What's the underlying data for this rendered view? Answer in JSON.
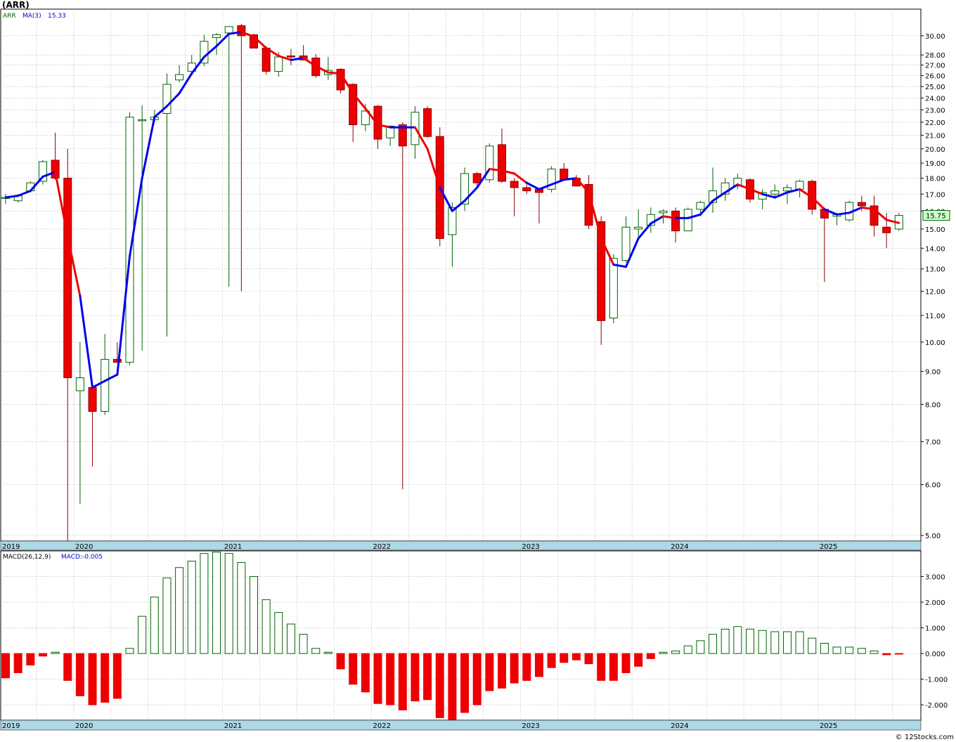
{
  "header": {
    "ticker": "(ARR)",
    "watermark": "© 12Stocks.com"
  },
  "colors": {
    "up_body": "#ffffff",
    "up_border": "#006400",
    "down_body": "#ee0000",
    "down_border": "#8b0000",
    "ma_up": "#0000ee",
    "ma_down": "#ee0000",
    "axis_band": "#add8e6",
    "grid": "#999999",
    "ma_label": "#0000cc",
    "last_price_bg": "#ccffcc"
  },
  "chart_data": [
    {
      "type": "candlestick",
      "legend": {
        "ticker_label": "ARR",
        "ma_label": "MA(3)",
        "ma_value": "15.33"
      },
      "last_price_label": "15.75",
      "y_scale": "log",
      "ylim": [
        4.9,
        33.0
      ],
      "y_ticks": [
        5,
        6,
        7,
        8,
        9,
        10,
        11,
        12,
        13,
        14,
        15,
        16,
        17,
        18,
        19,
        20,
        21,
        22,
        23,
        24,
        25,
        26,
        27,
        28,
        30
      ],
      "y_tick_labels": [
        "5.00",
        "6.00",
        "7.00",
        "8.00",
        "9.00",
        "10.00",
        "11.00",
        "12.00",
        "13.00",
        "14.00",
        "15.00",
        "16.00",
        "17.00",
        "18.00",
        "19.00",
        "20.00",
        "21.00",
        "22.00",
        "23.00",
        "24.00",
        "25.00",
        "26.00",
        "27.00",
        "28.00",
        "30.00"
      ],
      "x_labels": [
        {
          "label": "2019",
          "month": 0
        },
        {
          "label": "2020",
          "month": 3
        },
        {
          "label": "2021",
          "month": 15
        },
        {
          "label": "2022",
          "month": 27
        },
        {
          "label": "2023",
          "month": 39
        },
        {
          "label": "2024",
          "month": 51
        },
        {
          "label": "2025",
          "month": 63
        }
      ],
      "candles": [
        {
          "o": 16.8,
          "h": 17.0,
          "l": 16.4,
          "c": 16.8
        },
        {
          "o": 16.6,
          "h": 17.0,
          "l": 16.5,
          "c": 16.9
        },
        {
          "o": 17.2,
          "h": 17.8,
          "l": 17.1,
          "c": 17.7
        },
        {
          "o": 17.8,
          "h": 19.2,
          "l": 17.6,
          "c": 19.1
        },
        {
          "o": 19.2,
          "h": 21.2,
          "l": 17.9,
          "c": 18.0
        },
        {
          "o": 18.0,
          "h": 20.0,
          "l": 4.9,
          "c": 8.8
        },
        {
          "o": 8.4,
          "h": 10.0,
          "l": 5.6,
          "c": 8.8
        },
        {
          "o": 8.5,
          "h": 8.6,
          "l": 6.4,
          "c": 7.8
        },
        {
          "o": 7.8,
          "h": 10.3,
          "l": 7.7,
          "c": 9.4
        },
        {
          "o": 9.4,
          "h": 10.0,
          "l": 9.3,
          "c": 9.3
        },
        {
          "o": 9.3,
          "h": 22.8,
          "l": 9.2,
          "c": 22.4
        },
        {
          "o": 22.2,
          "h": 23.4,
          "l": 9.7,
          "c": 22.2
        },
        {
          "o": 22.2,
          "h": 23.0,
          "l": 22.0,
          "c": 22.4
        },
        {
          "o": 22.7,
          "h": 26.2,
          "l": 10.2,
          "c": 25.2
        },
        {
          "o": 25.6,
          "h": 27.0,
          "l": 25.4,
          "c": 26.1
        },
        {
          "o": 26.4,
          "h": 28.0,
          "l": 26.0,
          "c": 27.2
        },
        {
          "o": 27.2,
          "h": 30.1,
          "l": 26.9,
          "c": 29.4
        },
        {
          "o": 29.8,
          "h": 30.3,
          "l": 28.0,
          "c": 30.1
        },
        {
          "o": 30.3,
          "h": 31.0,
          "l": 12.2,
          "c": 31.0
        },
        {
          "o": 31.1,
          "h": 31.3,
          "l": 12.0,
          "c": 30.0
        },
        {
          "o": 30.1,
          "h": 30.2,
          "l": 28.7,
          "c": 28.7
        },
        {
          "o": 28.7,
          "h": 28.9,
          "l": 26.1,
          "c": 26.4
        },
        {
          "o": 26.4,
          "h": 28.3,
          "l": 25.9,
          "c": 27.8
        },
        {
          "o": 27.9,
          "h": 28.6,
          "l": 27.0,
          "c": 27.8
        },
        {
          "o": 27.9,
          "h": 29.0,
          "l": 27.5,
          "c": 27.5
        },
        {
          "o": 27.7,
          "h": 28.1,
          "l": 25.8,
          "c": 26.0
        },
        {
          "o": 26.1,
          "h": 27.8,
          "l": 25.6,
          "c": 26.5
        },
        {
          "o": 26.6,
          "h": 26.7,
          "l": 24.4,
          "c": 24.7
        },
        {
          "o": 25.2,
          "h": 25.3,
          "l": 20.5,
          "c": 21.8
        },
        {
          "o": 21.8,
          "h": 23.5,
          "l": 21.3,
          "c": 22.9
        },
        {
          "o": 23.3,
          "h": 23.4,
          "l": 20.0,
          "c": 20.7
        },
        {
          "o": 20.8,
          "h": 21.7,
          "l": 20.2,
          "c": 21.7
        },
        {
          "o": 21.8,
          "h": 22.0,
          "l": 5.9,
          "c": 20.2
        },
        {
          "o": 20.3,
          "h": 23.3,
          "l": 19.3,
          "c": 22.8
        },
        {
          "o": 23.1,
          "h": 23.3,
          "l": 20.8,
          "c": 20.9
        },
        {
          "o": 20.9,
          "h": 21.6,
          "l": 14.1,
          "c": 14.5
        },
        {
          "o": 14.7,
          "h": 16.5,
          "l": 13.1,
          "c": 16.2
        },
        {
          "o": 16.4,
          "h": 18.7,
          "l": 16.0,
          "c": 18.3
        },
        {
          "o": 18.3,
          "h": 18.4,
          "l": 17.4,
          "c": 17.7
        },
        {
          "o": 17.9,
          "h": 20.4,
          "l": 17.7,
          "c": 20.2
        },
        {
          "o": 20.3,
          "h": 21.5,
          "l": 17.7,
          "c": 17.8
        },
        {
          "o": 17.8,
          "h": 18.0,
          "l": 15.7,
          "c": 17.4
        },
        {
          "o": 17.4,
          "h": 17.6,
          "l": 17.0,
          "c": 17.2
        },
        {
          "o": 17.3,
          "h": 17.3,
          "l": 15.3,
          "c": 17.1
        },
        {
          "o": 17.3,
          "h": 18.8,
          "l": 17.1,
          "c": 18.6
        },
        {
          "o": 18.6,
          "h": 19.0,
          "l": 17.9,
          "c": 17.9
        },
        {
          "o": 18.0,
          "h": 18.2,
          "l": 17.5,
          "c": 17.5
        },
        {
          "o": 17.6,
          "h": 18.2,
          "l": 15.0,
          "c": 15.2
        },
        {
          "o": 15.4,
          "h": 15.7,
          "l": 9.9,
          "c": 10.8
        },
        {
          "o": 10.9,
          "h": 13.7,
          "l": 10.7,
          "c": 13.5
        },
        {
          "o": 13.4,
          "h": 15.7,
          "l": 13.3,
          "c": 15.1
        },
        {
          "o": 15.0,
          "h": 16.1,
          "l": 14.4,
          "c": 15.1
        },
        {
          "o": 15.2,
          "h": 16.2,
          "l": 14.8,
          "c": 15.8
        },
        {
          "o": 15.9,
          "h": 16.1,
          "l": 15.3,
          "c": 16.0
        },
        {
          "o": 16.0,
          "h": 16.2,
          "l": 14.3,
          "c": 14.9
        },
        {
          "o": 14.9,
          "h": 16.2,
          "l": 14.9,
          "c": 16.1
        },
        {
          "o": 16.1,
          "h": 16.6,
          "l": 15.7,
          "c": 16.5
        },
        {
          "o": 16.5,
          "h": 18.7,
          "l": 15.9,
          "c": 17.2
        },
        {
          "o": 17.0,
          "h": 18.0,
          "l": 16.6,
          "c": 17.7
        },
        {
          "o": 17.5,
          "h": 18.3,
          "l": 17.3,
          "c": 18.0
        },
        {
          "o": 17.9,
          "h": 18.0,
          "l": 16.5,
          "c": 16.7
        },
        {
          "o": 16.7,
          "h": 17.3,
          "l": 16.1,
          "c": 17.1
        },
        {
          "o": 17.0,
          "h": 17.6,
          "l": 16.7,
          "c": 17.2
        },
        {
          "o": 17.2,
          "h": 17.6,
          "l": 16.4,
          "c": 17.4
        },
        {
          "o": 17.3,
          "h": 17.9,
          "l": 16.8,
          "c": 17.8
        },
        {
          "o": 17.8,
          "h": 17.9,
          "l": 15.8,
          "c": 16.1
        },
        {
          "o": 16.1,
          "h": 16.2,
          "l": 12.4,
          "c": 15.6
        },
        {
          "o": 15.7,
          "h": 15.9,
          "l": 15.2,
          "c": 15.8
        },
        {
          "o": 15.5,
          "h": 16.6,
          "l": 15.4,
          "c": 16.5
        },
        {
          "o": 16.5,
          "h": 16.9,
          "l": 16.0,
          "c": 16.3
        },
        {
          "o": 16.3,
          "h": 16.9,
          "l": 14.6,
          "c": 15.2
        },
        {
          "o": 15.1,
          "h": 15.9,
          "l": 14.0,
          "c": 14.8
        },
        {
          "o": 15.0,
          "h": 15.9,
          "l": 14.9,
          "c": 15.75
        }
      ],
      "ma3": [
        16.8,
        16.9,
        17.2,
        18.1,
        18.4,
        14.6,
        11.8,
        8.5,
        8.7,
        8.9,
        13.6,
        18.0,
        22.4,
        23.3,
        24.4,
        26.2,
        27.8,
        28.9,
        30.2,
        30.4,
        29.9,
        28.7,
        27.9,
        27.5,
        27.7,
        26.9,
        26.3,
        26.2,
        24.4,
        23.1,
        21.8,
        21.6,
        21.6,
        21.6,
        20.0,
        17.4,
        16.0,
        16.6,
        17.4,
        18.6,
        18.5,
        18.3,
        17.7,
        17.3,
        17.6,
        17.9,
        18.0,
        17.1,
        14.5,
        13.2,
        13.1,
        14.5,
        15.3,
        15.7,
        15.6,
        15.6,
        15.8,
        16.6,
        17.1,
        17.6,
        17.3,
        17.0,
        16.8,
        17.1,
        17.3,
        16.8,
        16.1,
        15.8,
        15.9,
        16.2,
        16.1,
        15.5,
        15.33
      ],
      "ma3_up": [
        true,
        true,
        true,
        true,
        true,
        false,
        false,
        true,
        true,
        true,
        true,
        true,
        true,
        true,
        true,
        true,
        true,
        true,
        true,
        true,
        false,
        false,
        false,
        false,
        true,
        false,
        false,
        false,
        false,
        false,
        false,
        false,
        true,
        true,
        false,
        false,
        true,
        true,
        true,
        true,
        false,
        false,
        false,
        true,
        true,
        true,
        true,
        false,
        false,
        false,
        true,
        true,
        true,
        true,
        false,
        true,
        true,
        true,
        true,
        true,
        false,
        false,
        true,
        true,
        true,
        false,
        false,
        true,
        true,
        true,
        false,
        false,
        false
      ]
    },
    {
      "type": "bar",
      "legend": {
        "label": "MACD(26,12,9)",
        "value_label": "MACD:-0.005"
      },
      "ylim": [
        -2.6,
        4.0
      ],
      "y_ticks": [
        -2,
        -1,
        0,
        1,
        2,
        3
      ],
      "y_tick_labels": [
        "-2.000",
        "-1.000",
        "0.000",
        "1.000",
        "2.000",
        "3.000"
      ],
      "x_labels": [
        {
          "label": "2019",
          "month": 0
        },
        {
          "label": "2020",
          "month": 3
        },
        {
          "label": "2021",
          "month": 15
        },
        {
          "label": "2022",
          "month": 27
        },
        {
          "label": "2023",
          "month": 39
        },
        {
          "label": "2024",
          "month": 51
        },
        {
          "label": "2025",
          "month": 63
        }
      ],
      "values": [
        -0.95,
        -0.75,
        -0.45,
        -0.1,
        0.05,
        -1.05,
        -1.65,
        -2.0,
        -1.9,
        -1.75,
        0.2,
        1.45,
        2.2,
        2.95,
        3.35,
        3.6,
        3.9,
        3.95,
        3.9,
        3.55,
        3.0,
        2.1,
        1.6,
        1.15,
        0.75,
        0.2,
        0.05,
        -0.6,
        -1.2,
        -1.5,
        -1.95,
        -2.0,
        -2.2,
        -1.85,
        -1.8,
        -2.5,
        -2.6,
        -2.3,
        -2.0,
        -1.45,
        -1.35,
        -1.15,
        -1.05,
        -0.9,
        -0.55,
        -0.35,
        -0.25,
        -0.4,
        -1.05,
        -1.05,
        -0.75,
        -0.5,
        -0.2,
        0.05,
        0.1,
        0.3,
        0.5,
        0.75,
        0.95,
        1.05,
        0.95,
        0.9,
        0.85,
        0.85,
        0.85,
        0.6,
        0.4,
        0.25,
        0.25,
        0.2,
        0.1,
        -0.05,
        -0.01
      ]
    }
  ]
}
